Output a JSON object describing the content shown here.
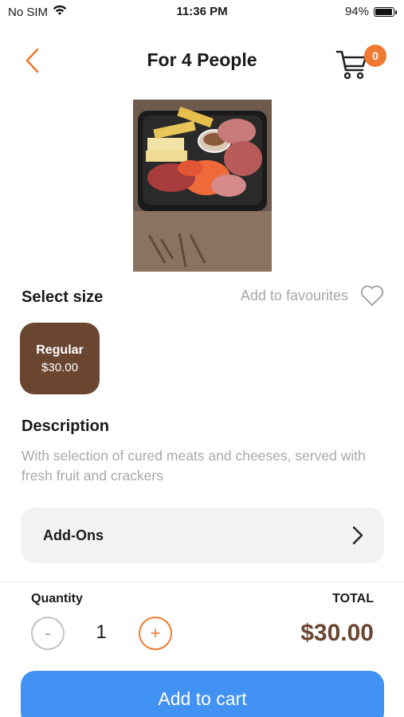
{
  "status_bar": {
    "carrier": "No SIM",
    "time": "11:36 PM",
    "battery_percent": "94%",
    "battery_level": 0.94
  },
  "nav": {
    "title": "For 4 People",
    "cart_count": "0",
    "accent_color": "#f07a30"
  },
  "product": {
    "image_alt": "Charcuterie board with cured meats and cheeses",
    "sizes_heading": "Select size",
    "favourites_label": "Add to favourites",
    "sizes": [
      {
        "name": "Regular",
        "price": "$30.00",
        "selected": true
      }
    ],
    "description_heading": "Description",
    "description": "With selection of cured meats and cheeses, served with fresh fruit and crackers",
    "addons_label": "Add-Ons"
  },
  "order": {
    "quantity_label": "Quantity",
    "quantity": "1",
    "minus_label": "-",
    "plus_label": "+",
    "total_label": "TOTAL",
    "total": "$30.00",
    "add_to_cart_label": "Add to cart",
    "button_color": "#4192f3",
    "price_color": "#6a4530"
  }
}
